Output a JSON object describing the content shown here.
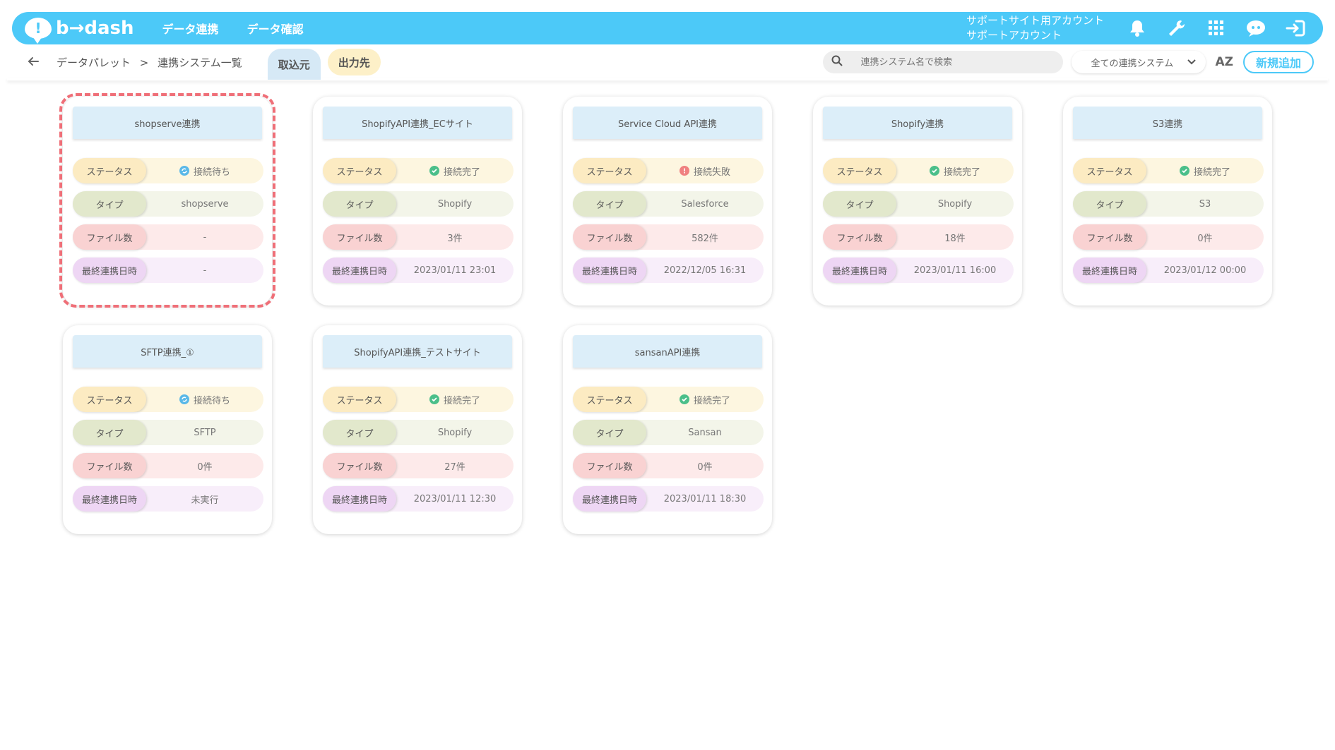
{
  "header": {
    "logo_text": "b→dash",
    "nav": [
      "データ連携",
      "データ確認"
    ],
    "account_line1": "サポートサイト用アカウント",
    "account_line2": "サポートアカウント",
    "icons": [
      "bell-icon",
      "wrench-icon",
      "grid-icon",
      "support-chat-icon",
      "logout-icon"
    ]
  },
  "subbar": {
    "breadcrumb_root": "データパレット",
    "breadcrumb_sep": ">",
    "breadcrumb_current": "連携システム一覧",
    "tab_import": "取込元",
    "tab_export": "出力先",
    "search_placeholder": "連携システム名で検索",
    "filter_value": "全ての連携システム",
    "sort_label": "AZ",
    "new_button": "新規追加"
  },
  "labels": {
    "status": "ステータス",
    "type": "タイプ",
    "files": "ファイル数",
    "last_sync": "最終連携日時"
  },
  "colors": {
    "accent": "#4cc9f8",
    "status_ok": "#4bbf8a",
    "status_wait": "#5ab8e8",
    "status_fail": "#f08080",
    "highlight": "#ef6f78"
  },
  "cards": [
    {
      "title": "shopserve連携",
      "status": "接続待ち",
      "status_kind": "wait",
      "type": "shopserve",
      "files": "-",
      "last_sync": "-"
    },
    {
      "title": "ShopifyAPI連携_ECサイト",
      "status": "接続完了",
      "status_kind": "ok",
      "type": "Shopify",
      "files": "3件",
      "last_sync": "2023/01/11 23:01"
    },
    {
      "title": "Service Cloud API連携",
      "status": "接続失敗",
      "status_kind": "fail",
      "type": "Salesforce",
      "files": "582件",
      "last_sync": "2022/12/05 16:31"
    },
    {
      "title": "Shopify連携",
      "status": "接続完了",
      "status_kind": "ok",
      "type": "Shopify",
      "files": "18件",
      "last_sync": "2023/01/11 16:00"
    },
    {
      "title": "S3連携",
      "status": "接続完了",
      "status_kind": "ok",
      "type": "S3",
      "files": "0件",
      "last_sync": "2023/01/12 00:00"
    },
    {
      "title": "SFTP連携_①",
      "status": "接続待ち",
      "status_kind": "wait",
      "type": "SFTP",
      "files": "0件",
      "last_sync": "未実行"
    },
    {
      "title": "ShopifyAPI連携_テストサイト",
      "status": "接続完了",
      "status_kind": "ok",
      "type": "Shopify",
      "files": "27件",
      "last_sync": "2023/01/11 12:30"
    },
    {
      "title": "sansanAPI連携",
      "status": "接続完了",
      "status_kind": "ok",
      "type": "Sansan",
      "files": "0件",
      "last_sync": "2023/01/11 18:30"
    }
  ]
}
